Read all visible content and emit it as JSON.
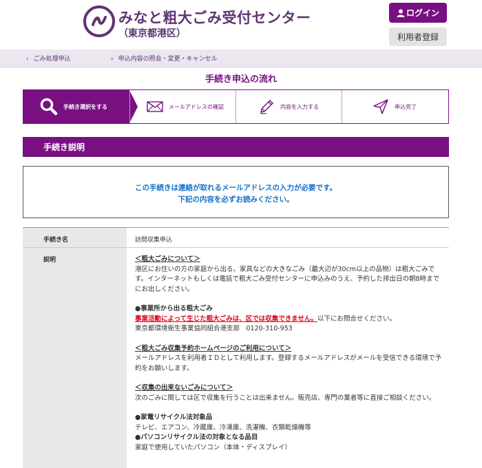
{
  "header": {
    "title": "みなと粗大ごみ受付センター",
    "subtitle": "（東京都港区）",
    "login_label": "ログイン",
    "register_label": "利用者登録"
  },
  "nav": {
    "items": [
      {
        "label": "ごみ処理申込"
      },
      {
        "label": "申込内容の照会・変更・キャンセル"
      }
    ]
  },
  "flow": {
    "title": "手続き申込の流れ",
    "steps": [
      {
        "label": "手続き選択をする",
        "icon": "search-icon"
      },
      {
        "label": "メールアドレスの確認",
        "icon": "mail-icon"
      },
      {
        "label": "内容を入力する",
        "icon": "pencil-icon"
      },
      {
        "label": "申込完了",
        "icon": "send-icon"
      }
    ]
  },
  "section": {
    "heading": "手続き説明"
  },
  "notice": {
    "line1": "この手続きは連絡が取れるメールアドレスの入力が必要です。",
    "line2": "下記の内容を必ずお読みください。"
  },
  "table": {
    "name_header": "手続き名",
    "name_value": "訪問収集申込",
    "desc_header": "説明",
    "desc": {
      "h1": "＜粗大ごみについて＞",
      "p1": "港区にお住いの方の家庭から出る、家具などの大きなごみ（最大辺が30cm以上の品物）は粗大ごみです。インターネットもしくは電話で粗大ごみ受付センターに申込みのうえ、予約した排出日の朝8時までにお出しください。",
      "h2": "●事業所から出る粗大ごみ",
      "red": "事業活動によって生じた粗大ごみは、区では収集できません。",
      "after_red": "以下にお問合せください。",
      "contact": "東京都環境衛生事業協同組合港支部　0120-310-953",
      "h3": "＜粗大ごみ収集予約ホームページのご利用について＞",
      "p3": "メールアドレスを利用者ＩＤとして利用します。登録するメールアドレスがメールを受信できる環境で予約をお願いします。",
      "h4": "＜収集の出来ないごみについて＞",
      "p4": "次のごみに関しては区で収集を行うことは出来ません。販売店、専門の業者等に直接ご相談ください。",
      "h5": "●家電リサイクル法対象品",
      "p5": "テレビ、エアコン、冷蔵庫、冷凍庫、洗濯機、衣類乾燥機等",
      "h6": "●パソコンリサイクル法の対象となる品目",
      "p6": "家庭で使用していたパソコン（本体・ディスプレイ）"
    }
  },
  "colors": {
    "brand": "#781082",
    "brand_dark": "#5f3470",
    "notice_text": "#1570c8",
    "warning": "#e0001a"
  }
}
